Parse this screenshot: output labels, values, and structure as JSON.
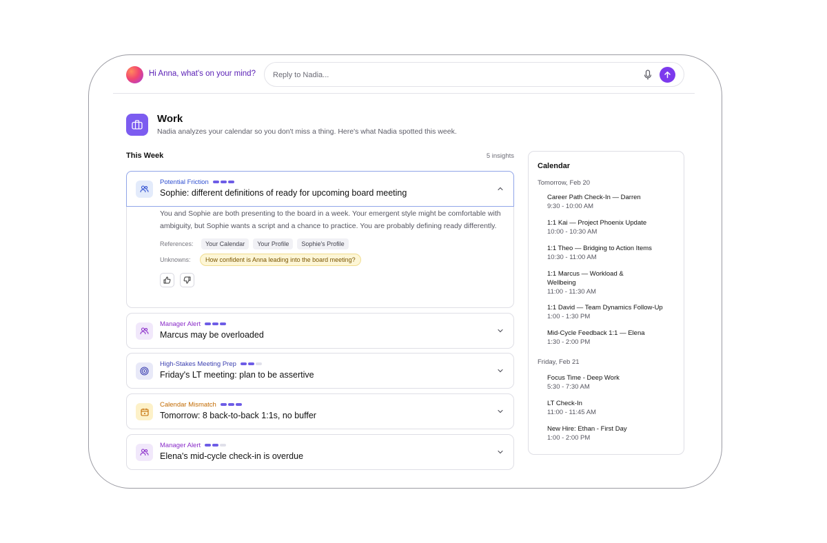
{
  "header": {
    "greeting": "Hi Anna, what's on your mind?",
    "reply_placeholder": "Reply to Nadia..."
  },
  "work": {
    "title": "Work",
    "subtitle": "Nadia analyzes your calendar so you don't miss a thing. Here's what Nadia spotted this week."
  },
  "section": {
    "label": "This Week",
    "count": "5 insights"
  },
  "insights": [
    {
      "category": "Potential Friction",
      "category_color": "#2f4fd1",
      "icon": "people-icon",
      "level": 3,
      "title": "Sophie: different definitions of ready for upcoming board meeting",
      "expanded": true,
      "body": "You and Sophie are both presenting to the board in a week. Your emergent style might be comfortable with ambiguity, but Sophie wants a script and a chance to practice. You are probably defining ready differently.",
      "references_label": "References:",
      "references": [
        "Your Calendar",
        "Your Profile",
        "Sophie's Profile"
      ],
      "unknowns_label": "Unknowns:",
      "unknowns": [
        "How confident is Anna leading into the board meeting?"
      ]
    },
    {
      "category": "Manager Alert",
      "category_color": "#8a2cc9",
      "icon": "people-icon",
      "level": 3,
      "title": "Marcus may be overloaded",
      "expanded": false
    },
    {
      "category": "High-Stakes Meeting Prep",
      "category_color": "#3b3fb0",
      "icon": "target-icon",
      "level": 2,
      "title": "Friday's LT meeting: plan to be assertive",
      "expanded": false
    },
    {
      "category": "Calendar Mismatch",
      "category_color": "#c26a00",
      "icon": "calendar-icon",
      "level": 3,
      "title": "Tomorrow: 8 back-to-back 1:1s, no buffer",
      "expanded": false
    },
    {
      "category": "Manager Alert",
      "category_color": "#8a2cc9",
      "icon": "people-icon",
      "level": 2,
      "title": "Elena's mid-cycle check-in is overdue",
      "expanded": false
    }
  ],
  "calendar": {
    "title": "Calendar",
    "days": [
      {
        "label": "Tomorrow, Feb 20",
        "events": [
          {
            "title": "Career Path Check-In — Darren",
            "time": "9:30 - 10:00 AM"
          },
          {
            "title": "1:1 Kai — Project Phoenix Update",
            "time": "10:00 - 10:30 AM"
          },
          {
            "title": "1:1 Theo — Bridging to Action Items",
            "time": "10:30 - 11:00 AM"
          },
          {
            "title": "1:1 Marcus — Workload & Wellbeing",
            "time": "11:00 - 11:30 AM"
          },
          {
            "title": "1:1 David — Team Dynamics Follow-Up",
            "time": "1:00 - 1:30 PM"
          },
          {
            "title": "Mid-Cycle Feedback 1:1 — Elena",
            "time": "1:30 - 2:00 PM"
          }
        ]
      },
      {
        "label": "Friday, Feb 21",
        "events": [
          {
            "title": "Focus Time - Deep Work",
            "time": "5:30 - 7:30 AM"
          },
          {
            "title": "LT Check-In",
            "time": "11:00 - 11:45 AM"
          },
          {
            "title": "New Hire: Ethan - First Day",
            "time": "1:00 - 2:00 PM"
          }
        ]
      }
    ]
  },
  "colors": {
    "accent": "#7c3aed",
    "work_icon_bg": "#7c5cf0",
    "level_bar": "#6d5ce6"
  }
}
